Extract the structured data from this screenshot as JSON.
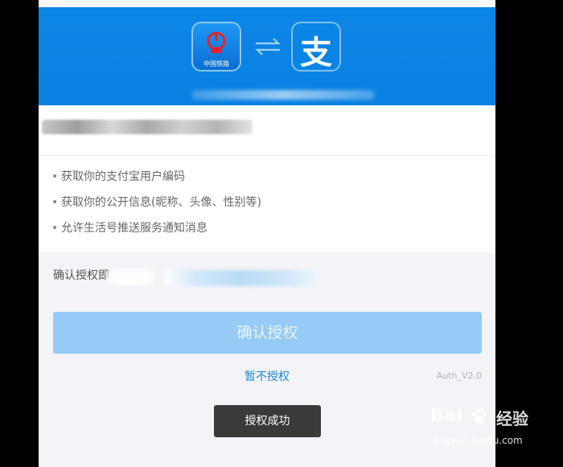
{
  "header": {
    "railway_icon_label": "中国铁路",
    "alipay_icon_char": "支"
  },
  "permissions": [
    "获取你的支付宝用户编码",
    "获取你的公开信息(昵称、头像、性别等)",
    "允许生活号推送服务通知消息"
  ],
  "agree_prefix": "确认授权即",
  "confirm_label": "确认授权",
  "deny_label": "暂不授权",
  "version": "Auth_V2.0",
  "toast": "授权成功",
  "watermark": {
    "brand_left": "Bai",
    "brand_right": "经验",
    "domain": "jingyan.baidu.com"
  },
  "colors": {
    "header_blue": "#0a81e2",
    "confirm_button": "#95cbf6",
    "link_blue": "#1b84db"
  }
}
